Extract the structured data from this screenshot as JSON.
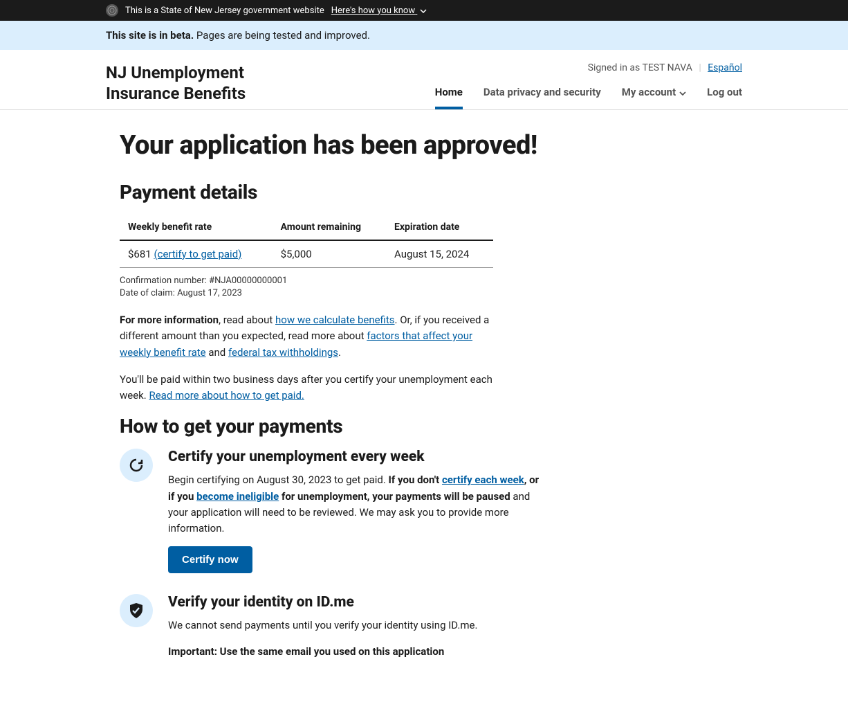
{
  "gov_banner": {
    "text": "This is a State of New Jersey government website",
    "toggle": "Here's how you know"
  },
  "beta": {
    "strong": "This site is in beta.",
    "rest": " Pages are being tested and improved."
  },
  "header": {
    "site_title": "NJ Unemployment Insurance Benefits",
    "signed_in_prefix": "Signed in as ",
    "signed_in_user": "TEST NAVA",
    "lang": "Español",
    "nav": {
      "home": "Home",
      "privacy": "Data privacy and security",
      "account": "My account",
      "logout": "Log out"
    }
  },
  "main": {
    "h1": "Your application has been approved!",
    "payment_h2": "Payment details",
    "table": {
      "th1": "Weekly benefit rate",
      "th2": "Amount remaining",
      "th3": "Expiration date",
      "rate": "$681 ",
      "rate_link": "(certify to get paid)",
      "remaining": "$5,000",
      "exp": "August 15, 2024"
    },
    "conf_line": "Confirmation number: #NJA00000000001",
    "date_line": "Date of claim: August 17, 2023",
    "para1": {
      "strong": "For more information",
      "a": ", read about ",
      "link1": "how we calculate benefits",
      "b": ". Or, if you received a different amount than you expected, read more about ",
      "link2": "factors that affect your weekly benefit rate",
      "c": " and ",
      "link3": "federal tax withholdings",
      "d": "."
    },
    "para2": {
      "a": "You'll be paid within two business days after you certify your unemployment each week. ",
      "link": "Read more about how to get paid."
    },
    "how_h2": "How to get your payments",
    "step1": {
      "h3": "Certify your unemployment every week",
      "a": "Begin certifying on August 30, 2023 to get paid. ",
      "b_strong": "If you don't ",
      "link1": "certify each week",
      "c_strong": ", or if you ",
      "link2": "become ineligible",
      "d_strong": " for unemployment, your payments will be paused",
      "e": " and your application will need to be reviewed. We may ask you to provide more information.",
      "btn": "Certify now"
    },
    "step2": {
      "h3": "Verify your identity on ID.me",
      "a": "We cannot send payments until you verify your identity using ID.me.",
      "b_strong": "Important: Use the same email you used on this application"
    }
  }
}
